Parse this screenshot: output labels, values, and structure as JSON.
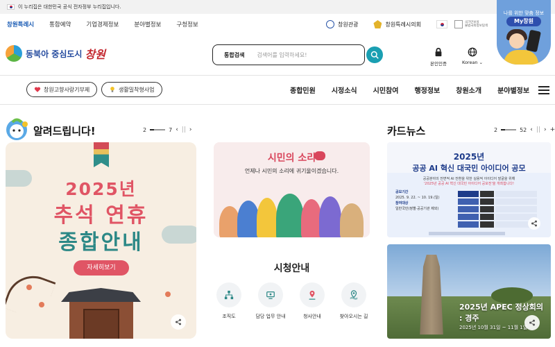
{
  "gov_banner": {
    "text": "이 누리집은 대한민국 공식 전자정부 누리집입니다."
  },
  "util_nav": {
    "items": [
      {
        "label": "창원특례시"
      },
      {
        "label": "통합예약"
      },
      {
        "label": "기업경제정보"
      },
      {
        "label": "분야별정보"
      },
      {
        "label": "구청정보"
      }
    ],
    "tourism": "창원관광",
    "council": "창원특례시의회",
    "nsc_line1": "국가안보실",
    "nsc_line2": "불법국외정보탐색"
  },
  "promo": {
    "line1": "나를 위한 맞춤 정보",
    "label": "My창원"
  },
  "header": {
    "logo_text": "동북아 중심도시",
    "logo_script": "창원",
    "search_label": "통합검색",
    "search_placeholder": "검색어를 입력하세요!",
    "auth_label": "본인인증",
    "lang_label": "Korean"
  },
  "nav": {
    "pill1": "창원고향사랑기부제",
    "pill2": "생활밀착형사업",
    "menu": [
      {
        "label": "종합민원"
      },
      {
        "label": "시정소식"
      },
      {
        "label": "시민참여"
      },
      {
        "label": "행정정보"
      },
      {
        "label": "창원소개"
      },
      {
        "label": "분야별정보"
      }
    ]
  },
  "notices": {
    "title": "알려드립니다!",
    "page_current": "2",
    "page_total": "7",
    "card": {
      "year": "2025년",
      "line1": "추석 연휴",
      "line2": "종합안내",
      "more": "자세히보기"
    }
  },
  "voice": {
    "title": "시민의 소리",
    "subtitle": "언제나 시민의 소리에 귀기울이겠습니다."
  },
  "guide": {
    "title": "시청안내",
    "items": [
      {
        "label": "조직도",
        "icon": "org-chart-icon"
      },
      {
        "label": "담당 업무 안내",
        "icon": "desk-icon"
      },
      {
        "label": "청사안내",
        "icon": "building-pin-icon"
      },
      {
        "label": "찾아오시는 길",
        "icon": "map-pin-icon"
      }
    ]
  },
  "card_news": {
    "title": "카드뉴스",
    "page_current": "2",
    "page_total": "52",
    "ai": {
      "year": "2025년",
      "title": "공공 AI 혁신 대국민 아이디어 공모",
      "sub1": "공공분야의 전면적 AI 전환을 위한 실용적 아이디어 발굴을 위해",
      "sub2": "'2025년 공공 AI 혁신 대국민 아이디어 공모전'을 개최합니다!",
      "left1": "공모기간",
      "left2": "2025. 9. 22. ~ 10. 19.(일)",
      "left3": "참여대상",
      "left4": "일반국민(정별·공공기관 제외)"
    },
    "apec": {
      "title": "2025년 APEC 정상회의",
      "sub": ": 경주",
      "date": "2025년 10월 31일 ~ 11월 1일"
    }
  },
  "colors": {
    "brand_blue": "#234a9e",
    "accent_teal": "#1a9fb2",
    "festival_red": "#e05565",
    "festival_teal": "#2c8886"
  }
}
